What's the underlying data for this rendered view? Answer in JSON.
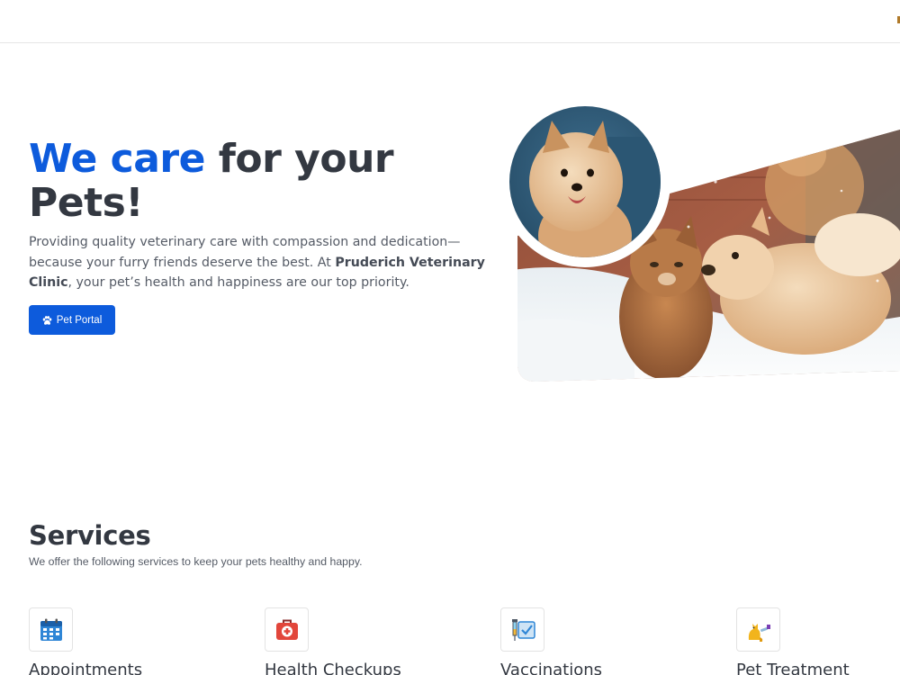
{
  "hero": {
    "title_accent": "We care",
    "title_rest": " for your Pets!",
    "description_start": "Providing quality veterinary care with compassion and dedication—because your furry friends deserve the best. At ",
    "clinic_name": "Pruderich Veterinary Clinic",
    "description_end": ", your pet’s health and happiness are our top priority.",
    "button_label": "Pet Portal",
    "button_icon": "paw-icon",
    "accent_color": "#0d5bdc"
  },
  "services": {
    "title": "Services",
    "subtitle": "We offer the following services to keep your pets healthy and happy.",
    "items": [
      {
        "title": "Appointments",
        "icon": "calendar-icon"
      },
      {
        "title": "Health Checkups",
        "icon": "first-aid-kit-icon"
      },
      {
        "title": "Vaccinations",
        "icon": "syringe-icon"
      },
      {
        "title": "Pet Treatment",
        "icon": "pet-treatment-icon"
      }
    ]
  }
}
